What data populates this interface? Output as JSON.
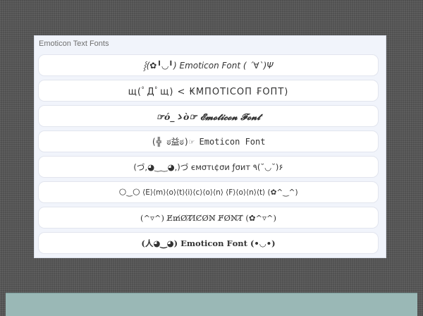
{
  "panel": {
    "title": "Emoticon Text Fonts"
  },
  "fonts": [
    {
      "text": "⸾(✿╹◡╹) Emoticon Font ( ´∀`)Ψ"
    },
    {
      "text": "щ(ﾟДﾟщ) < ₭ΜΠΟΤΙϹΟΠ ₣ΟΠΤ)"
    },
    {
      "text": "☞ό_ゝò☞ 𝓔𝓶𝓸𝓽𝓲𝓬𝓸𝓷 𝓕𝓸𝓷𝓽"
    },
    {
      "text": "(╬ ಠ益ಠ)☞ Emoticon Font"
    },
    {
      "text": "(づ,◕‿‿◕,)づ ємσтι¢σи ƒσит ٩(˘◡˘)۶"
    },
    {
      "text": "🌕‿🌕 ⟨E⟩⟨m⟩⟨o⟩⟨t⟩⟨i⟩⟨c⟩⟨o⟩⟨n⟩ ⟨F⟩⟨o⟩⟨n⟩⟨t⟩ (✿^‿^)"
    },
    {
      "text": "(^▿^) E̸m̸O̸T̸I̸C̸O̸N̸ F̸O̸N̸T̸ (✿^▿^)"
    },
    {
      "text": "(人◕‿◕) 𝐄𝐦𝐨𝐭𝐢𝐜𝐨𝐧 𝐅𝐨𝐧𝐭 (•◡•)"
    }
  ]
}
